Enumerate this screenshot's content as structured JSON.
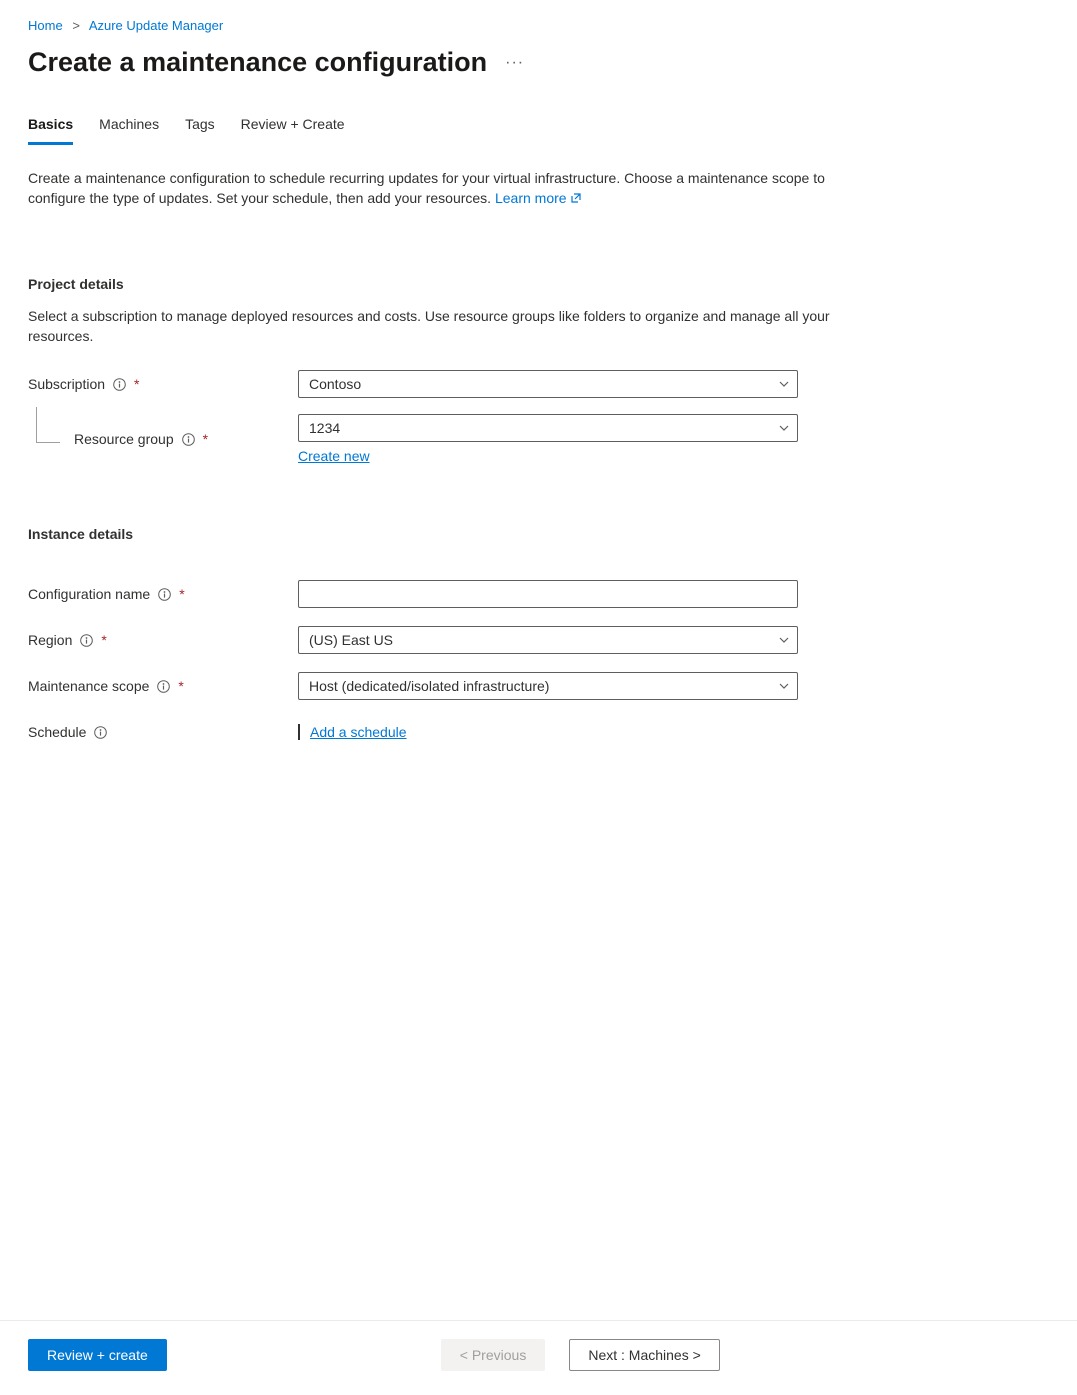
{
  "breadcrumb": {
    "home": "Home",
    "parent": "Azure Update Manager"
  },
  "header": {
    "title": "Create a maintenance configuration"
  },
  "tabs": {
    "basics": "Basics",
    "machines": "Machines",
    "tags": "Tags",
    "review": "Review + Create"
  },
  "intro": {
    "text": "Create a maintenance configuration to schedule recurring updates for your virtual infrastructure. Choose a maintenance scope to configure the type of updates. Set your schedule, then add your resources. ",
    "learn_more": "Learn more"
  },
  "sections": {
    "project_details": {
      "title": "Project details",
      "desc": "Select a subscription to manage deployed resources and costs. Use resource groups like folders to organize and manage all your resources."
    },
    "instance_details": {
      "title": "Instance details"
    }
  },
  "fields": {
    "subscription": {
      "label": "Subscription",
      "value": "Contoso"
    },
    "resource_group": {
      "label": "Resource group",
      "value": "1234",
      "create_new": "Create new"
    },
    "configuration_name": {
      "label": "Configuration name",
      "value": ""
    },
    "region": {
      "label": "Region",
      "value": "(US) East US"
    },
    "maintenance_scope": {
      "label": "Maintenance scope",
      "value": "Host (dedicated/isolated infrastructure)"
    },
    "schedule": {
      "label": "Schedule",
      "add_link": "Add a schedule"
    }
  },
  "footer": {
    "review_create": "Review + create",
    "previous": "< Previous",
    "next": "Next : Machines >"
  }
}
